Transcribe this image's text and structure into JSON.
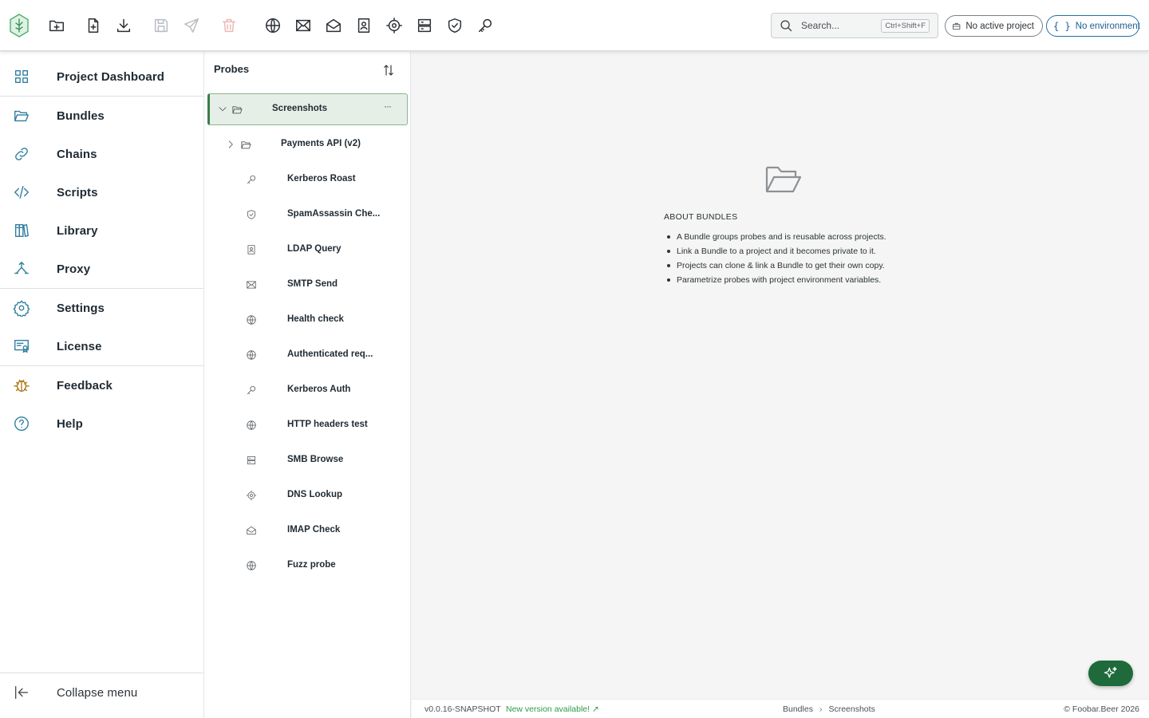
{
  "topbar": {
    "search": {
      "placeholder": "Search...",
      "shortcut": "Ctrl+Shift+F"
    },
    "project_pill": "No active project",
    "environment_pill": "No environment"
  },
  "sidebar": {
    "items": [
      {
        "label": "Project Dashboard",
        "icon": "grid-icon"
      },
      {
        "label": "Bundles",
        "icon": "folder-open-icon"
      },
      {
        "label": "Chains",
        "icon": "link-icon"
      },
      {
        "label": "Scripts",
        "icon": "code-icon"
      },
      {
        "label": "Library",
        "icon": "library-icon"
      },
      {
        "label": "Proxy",
        "icon": "split-arrows-icon"
      },
      {
        "label": "Settings",
        "icon": "gear-icon"
      },
      {
        "label": "License",
        "icon": "certificate-icon"
      },
      {
        "label": "Feedback",
        "icon": "bug-icon"
      },
      {
        "label": "Help",
        "icon": "help-circle-icon"
      }
    ],
    "collapse_label": "Collapse menu"
  },
  "probes": {
    "title": "Probes",
    "folder": "Screenshots",
    "folder_menu": "···",
    "subfolder": "Payments API (v2)",
    "items": [
      {
        "label": "Kerberos Roast",
        "icon": "key-icon"
      },
      {
        "label": "SpamAssassin Che...",
        "icon": "shield-check-icon"
      },
      {
        "label": "LDAP Query",
        "icon": "address-book-icon"
      },
      {
        "label": "SMTP Send",
        "icon": "mail-icon"
      },
      {
        "label": "Health check",
        "icon": "globe-icon"
      },
      {
        "label": "Authenticated req...",
        "icon": "globe-icon"
      },
      {
        "label": "Kerberos Auth",
        "icon": "key-icon"
      },
      {
        "label": "HTTP headers test",
        "icon": "globe-icon"
      },
      {
        "label": "SMB Browse",
        "icon": "server-icon"
      },
      {
        "label": "DNS Lookup",
        "icon": "crosshair-icon"
      },
      {
        "label": "IMAP Check",
        "icon": "mail-open-icon"
      },
      {
        "label": "Fuzz probe",
        "icon": "globe-icon"
      }
    ]
  },
  "about": {
    "title": "ABOUT BUNDLES",
    "points": [
      "A Bundle groups probes and is reusable across projects.",
      "Link a Bundle to a project and it becomes private to it.",
      "Projects can clone & link a Bundle to get their own copy.",
      "Parametrize probes with project environment variables."
    ]
  },
  "footer": {
    "version": "v0.0.16-SNAPSHOT",
    "new_version": "New version available! ↗",
    "breadcrumb": [
      "Bundles",
      "Screenshots"
    ],
    "copyright": "© Foobar.Beer 2026"
  }
}
